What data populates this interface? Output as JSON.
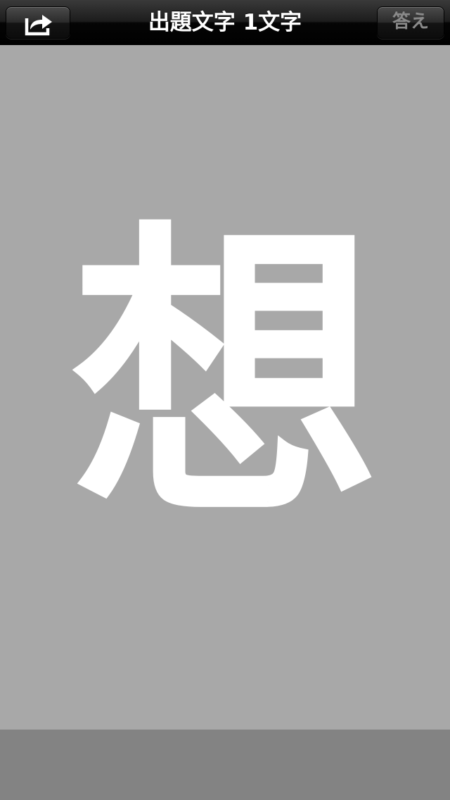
{
  "navbar": {
    "title": "出題文字 1文字",
    "share_icon": "share-arrow-icon",
    "answer_label": "答え"
  },
  "main": {
    "kanji": "想"
  },
  "colors": {
    "background": "#a8a8a8",
    "navbar": "#000000",
    "bottom_bar": "#838383",
    "kanji": "#ffffff",
    "answer_disabled": "#8a8a8a"
  }
}
